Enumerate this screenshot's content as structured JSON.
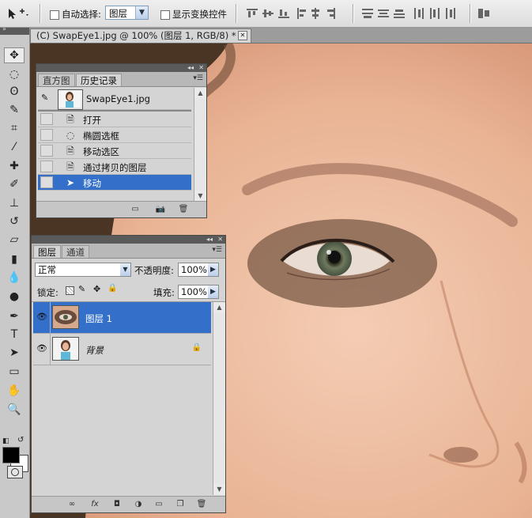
{
  "options_bar": {
    "move_tool_icon": "move-arrow-icon",
    "auto_select_label": "自动选择:",
    "auto_select_value": "图层",
    "show_transform_label": "显示变换控件"
  },
  "tools": [
    {
      "name": "move-tool-icon",
      "glyph": "✥",
      "selected": true
    },
    {
      "name": "marquee-tool-icon",
      "glyph": "◌"
    },
    {
      "name": "lasso-tool-icon",
      "glyph": "ʘ"
    },
    {
      "name": "quick-select-tool-icon",
      "glyph": "✎"
    },
    {
      "name": "crop-tool-icon",
      "glyph": "⌗"
    },
    {
      "name": "eyedropper-tool-icon",
      "glyph": "⁄"
    },
    {
      "name": "healing-brush-tool-icon",
      "glyph": "✚"
    },
    {
      "name": "brush-tool-icon",
      "glyph": "✐"
    },
    {
      "name": "clone-stamp-tool-icon",
      "glyph": "⊥"
    },
    {
      "name": "history-brush-tool-icon",
      "glyph": "↺"
    },
    {
      "name": "eraser-tool-icon",
      "glyph": "▱"
    },
    {
      "name": "gradient-tool-icon",
      "glyph": "▮"
    },
    {
      "name": "blur-tool-icon",
      "glyph": "💧"
    },
    {
      "name": "dodge-tool-icon",
      "glyph": "●"
    },
    {
      "name": "pen-tool-icon",
      "glyph": "✒"
    },
    {
      "name": "type-tool-icon",
      "glyph": "T"
    },
    {
      "name": "path-select-tool-icon",
      "glyph": "➤"
    },
    {
      "name": "shape-tool-icon",
      "glyph": "▭"
    },
    {
      "name": "hand-tool-icon",
      "glyph": "✋"
    },
    {
      "name": "zoom-tool-icon",
      "glyph": "🔍"
    }
  ],
  "document": {
    "tab_title": "(C) SwapEye1.jpg @ 100% (图层 1, RGB/8) *"
  },
  "history_panel": {
    "tabs": [
      "直方图",
      "历史记录"
    ],
    "snapshot_label": "SwapEye1.jpg",
    "steps": [
      {
        "label": "打开",
        "icon": "document-icon"
      },
      {
        "label": "椭圆选框",
        "icon": "ellipse-marquee-icon"
      },
      {
        "label": "移动选区",
        "icon": "document-icon"
      },
      {
        "label": "通过拷贝的图层",
        "icon": "document-icon"
      },
      {
        "label": "移动",
        "icon": "move-arrow-icon",
        "selected": true
      }
    ]
  },
  "layers_panel": {
    "tabs": [
      "图层",
      "通道"
    ],
    "blend_mode": "正常",
    "opacity_label": "不透明度:",
    "opacity_value": "100%",
    "lock_label": "锁定:",
    "fill_label": "填充:",
    "fill_value": "100%",
    "layers": [
      {
        "name": "图层 1",
        "selected": true
      },
      {
        "name": "背景",
        "locked": true
      }
    ]
  },
  "colors": {
    "accent_selection": "#3470c9",
    "foreground": "#000000",
    "background": "#ffffff"
  }
}
